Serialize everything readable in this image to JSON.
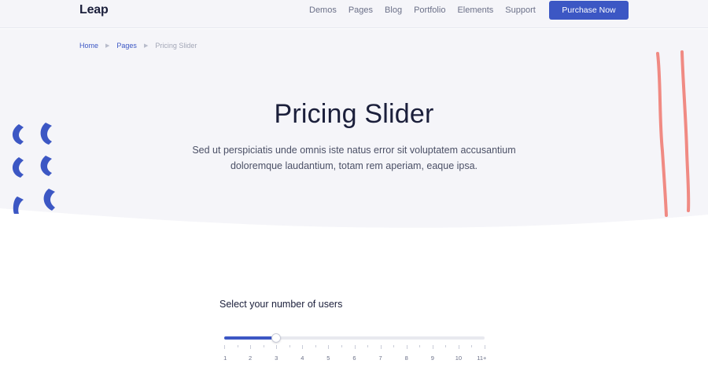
{
  "brand": {
    "logo": "Leap",
    "accent": "#3c57c4",
    "coral": "#f08a83"
  },
  "nav": {
    "links": [
      "Demos",
      "Pages",
      "Blog",
      "Portfolio",
      "Elements",
      "Support"
    ],
    "cta": "Purchase Now"
  },
  "breadcrumb": {
    "items": [
      "Home",
      "Pages"
    ],
    "current": "Pricing Slider"
  },
  "hero": {
    "title": "Pricing Slider",
    "subtitle": "Sed ut perspiciatis unde omnis iste natus error sit voluptatem accusantium doloremque laudantium, totam rem aperiam, eaque ipsa."
  },
  "slider": {
    "label": "Select your number of users",
    "tick_labels": [
      "1",
      "2",
      "3",
      "4",
      "5",
      "6",
      "7",
      "8",
      "9",
      "10",
      "11+"
    ],
    "value_label": "3",
    "value_fraction": 0.2
  },
  "icons": {
    "breadcrumb_separator": "triangle-right-icon"
  }
}
